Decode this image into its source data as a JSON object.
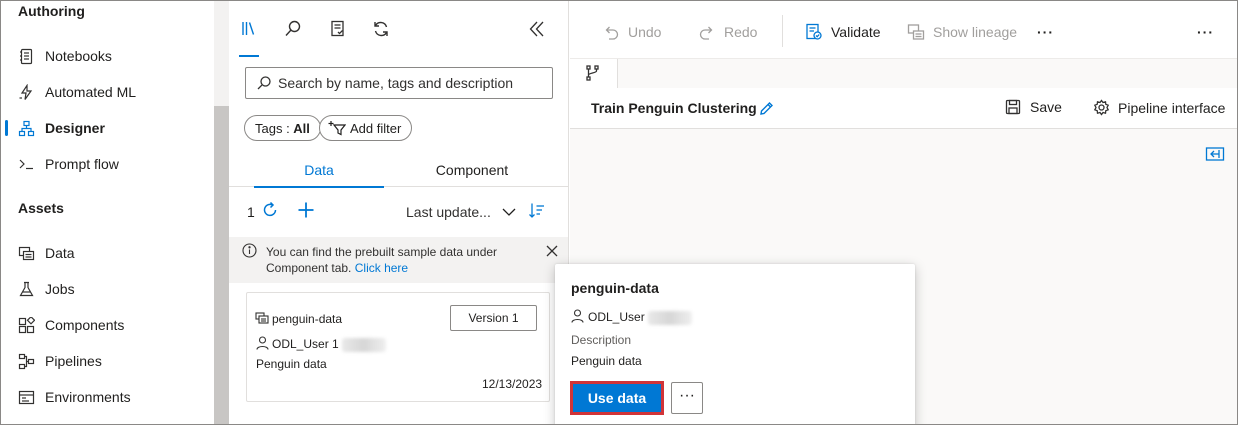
{
  "leftnav": {
    "authoring_heading": "Authoring",
    "assets_heading": "Assets",
    "authoring_items": [
      {
        "label": "Notebooks",
        "icon": "notebook-icon"
      },
      {
        "label": "Automated ML",
        "icon": "automated-ml-icon"
      },
      {
        "label": "Designer",
        "icon": "designer-icon",
        "active": true
      },
      {
        "label": "Prompt flow",
        "icon": "prompt-flow-icon"
      }
    ],
    "asset_items": [
      {
        "label": "Data",
        "icon": "data-icon"
      },
      {
        "label": "Jobs",
        "icon": "jobs-flask-icon"
      },
      {
        "label": "Components",
        "icon": "components-icon"
      },
      {
        "label": "Pipelines",
        "icon": "pipelines-icon"
      },
      {
        "label": "Environments",
        "icon": "environments-icon"
      }
    ]
  },
  "panel": {
    "tools": [
      "library-icon",
      "search-icon",
      "checklist-icon",
      "refresh-icon"
    ],
    "collapse_icon": "double-chevron-left-icon",
    "search_placeholder": "Search by name, tags and description",
    "tags_filter": {
      "prefix": "Tags : ",
      "value": "All"
    },
    "add_filter_label": "Add filter",
    "tabs": [
      "Data",
      "Component"
    ],
    "active_tab": "Data",
    "count": "1",
    "sort_label": "Last update...",
    "info_text": "You can find the prebuilt sample data under Component tab.",
    "info_link": "Click here",
    "card": {
      "name": "penguin-data",
      "version_label": "Version 1",
      "user": "ODL_User 1",
      "description": "Penguin data",
      "date": "12/13/2023"
    }
  },
  "toolbar": {
    "undo": "Undo",
    "redo": "Redo",
    "validate": "Validate",
    "show_lineage": "Show lineage",
    "more": "···"
  },
  "pipeline": {
    "title": "Train Penguin Clustering",
    "save": "Save",
    "pipeline_interface": "Pipeline interface"
  },
  "popup": {
    "title": "penguin-data",
    "user": "ODL_User",
    "description_label": "Description",
    "description": "Penguin data",
    "use_data_label": "Use data",
    "more_label": "···"
  },
  "colors": {
    "accent": "#0078d4",
    "highlight_border": "#d13438",
    "disabled_text": "#a19f9d"
  }
}
